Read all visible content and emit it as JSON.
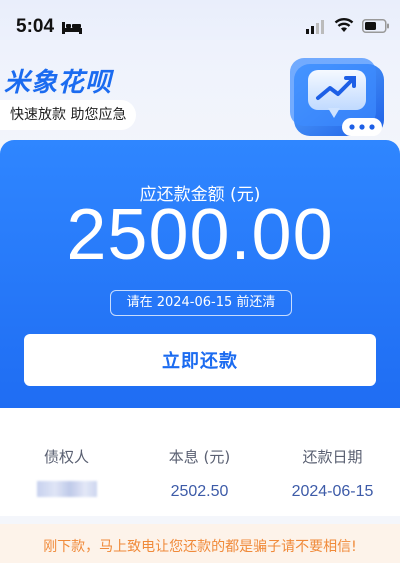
{
  "status_bar": {
    "time": "5:04",
    "icons": [
      "bed-icon",
      "signal-icon",
      "wifi-icon",
      "battery-icon"
    ]
  },
  "header": {
    "brand": "米象花呗",
    "slogan": "快速放款 助您应急",
    "hero_icon": "chart-chat-icon"
  },
  "repayment": {
    "amount_label": "应还款金额 (元)",
    "amount": "2500.00",
    "due_note": "请在 2024-06-15 前还清",
    "pay_button": "立即还款"
  },
  "details": {
    "columns": [
      {
        "label": "债权人",
        "value": ""
      },
      {
        "label": "本息 (元)",
        "value": "2502.50"
      },
      {
        "label": "还款日期",
        "value": "2024-06-15"
      }
    ]
  },
  "warning": "刚下款，马上致电让您还款的都是骗子请不要相信!",
  "colors": {
    "primary_blue": "#2f86ff",
    "brand_blue": "#1b6bf0",
    "warning_orange": "#f08a3a"
  }
}
